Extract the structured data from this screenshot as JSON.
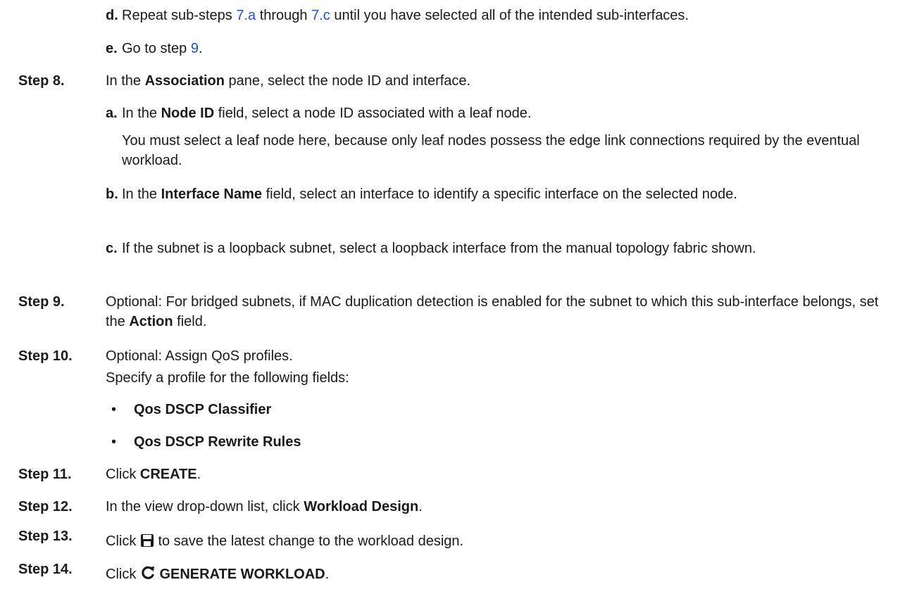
{
  "step7": {
    "d": {
      "label": "d.",
      "pre": "Repeat sub-steps ",
      "link1": "7.a",
      "mid": " through ",
      "link2": "7.c",
      "post": " until you have selected all of the intended sub-interfaces."
    },
    "e": {
      "label": "e.",
      "pre": "Go to step ",
      "link": "9",
      "post": "."
    }
  },
  "step8": {
    "label": "Step 8.",
    "pre": "In the ",
    "bold": "Association",
    "post": " pane, select the node ID and interface.",
    "a": {
      "label": "a.",
      "pre": "In the ",
      "bold": "Node ID",
      "post": " field, select a node ID associated with a leaf node.",
      "note": "You must select a leaf node here, because only leaf nodes possess the edge link connections required by the eventual workload."
    },
    "b": {
      "label": "b.",
      "pre": "In the ",
      "bold": "Interface Name",
      "post": " field, select an interface to identify a specific interface on the selected node."
    },
    "c": {
      "label": "c.",
      "text": "If the subnet is a loopback subnet, select a loopback interface from the manual topology fabric shown."
    }
  },
  "step9": {
    "label": "Step 9.",
    "pre": "Optional: For bridged subnets, if MAC duplication detection is enabled for the subnet to which this sub-interface belongs, set the ",
    "bold": "Action",
    "post": " field."
  },
  "step10": {
    "label": "Step 10.",
    "text": "Optional: Assign QoS profiles.",
    "sub": "Specify a profile for the following fields:",
    "bullet": "•",
    "items": [
      "Qos DSCP Classifier",
      "Qos DSCP Rewrite Rules"
    ]
  },
  "step11": {
    "label": "Step 11.",
    "pre": "Click ",
    "bold": "CREATE",
    "post": "."
  },
  "step12": {
    "label": "Step 12.",
    "pre": "In the view drop-down list, click ",
    "bold": "Workload Design",
    "post": "."
  },
  "step13": {
    "label": "Step 13.",
    "pre": "Click ",
    "icon": "save-icon",
    "post": " to save the latest change to the workload design."
  },
  "step14": {
    "label": "Step 14.",
    "pre": "Click ",
    "icon": "refresh-icon",
    "bold": "GENERATE WORKLOAD",
    "post": "."
  }
}
